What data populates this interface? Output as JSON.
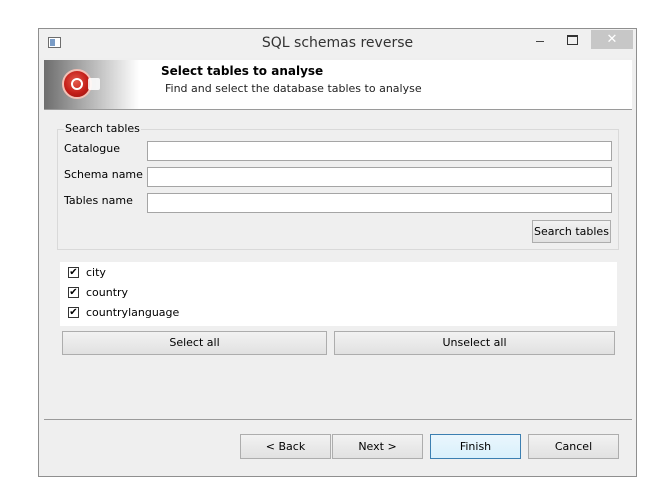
{
  "window": {
    "title": "SQL schemas reverse",
    "close_glyph": "✕"
  },
  "header": {
    "title": "Select tables to analyse",
    "subtitle": "Find and select the database tables to analyse",
    "logo_icon": "dbschema-logo-icon"
  },
  "search": {
    "group_label": "Search tables",
    "fields": [
      {
        "label": "Catalogue",
        "value": "",
        "placeholder": ""
      },
      {
        "label": "Schema name",
        "value": "",
        "placeholder": ""
      },
      {
        "label": "Tables name",
        "value": "",
        "placeholder": ""
      }
    ],
    "search_button": "Search tables"
  },
  "tables": [
    {
      "name": "city",
      "checked": true
    },
    {
      "name": "country",
      "checked": true
    },
    {
      "name": "countrylanguage",
      "checked": true
    }
  ],
  "check_glyph": "✔",
  "selection": {
    "select_all": "Select all",
    "unselect_all": "Unselect all"
  },
  "footer": {
    "back": "< Back",
    "next": "Next >",
    "finish": "Finish",
    "cancel": "Cancel"
  },
  "colors": {
    "accent_red": "#c41e18",
    "window_bg": "#efefef",
    "default_button_border": "#3c7fb1"
  }
}
